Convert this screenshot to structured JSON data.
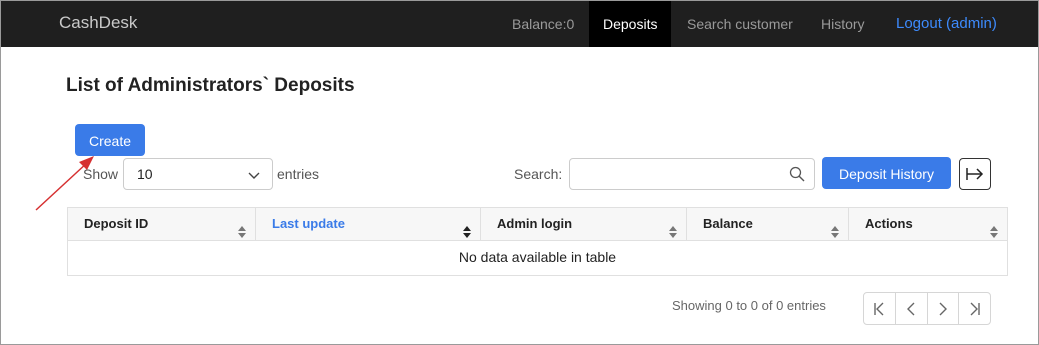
{
  "navbar": {
    "brand": "CashDesk",
    "balance": "Balance:0",
    "deposits": "Deposits",
    "search_customer": "Search customer",
    "history": "History",
    "logout": "Logout (admin)"
  },
  "page_title": "List of Administrators` Deposits",
  "create_label": "Create",
  "length": {
    "show": "Show",
    "value": "10",
    "entries": "entries"
  },
  "search": {
    "label": "Search:",
    "value": "",
    "placeholder": ""
  },
  "deposit_history_label": "Deposit History",
  "icons": {
    "export": "arrow-right-to-bar-icon",
    "search": "search-icon",
    "select": "chevron-down-icon",
    "sort": "sort-icon"
  },
  "table": {
    "columns": [
      "Deposit ID",
      "Last update",
      "Admin login",
      "Balance",
      "Actions"
    ],
    "sorted_column": "Last update",
    "empty_message": "No data available in table"
  },
  "info": "Showing 0 to 0 of 0 entries",
  "colors": {
    "navbar_bg": "#1f1f1f",
    "primary": "#3a7be8",
    "logout_link": "#3d8bfd",
    "annotation_arrow": "#d63031"
  }
}
